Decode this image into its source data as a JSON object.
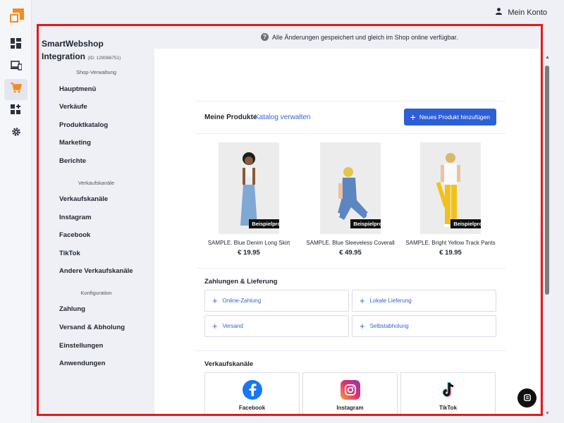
{
  "rail": {
    "items": [
      {
        "icon": "dashboard-icon"
      },
      {
        "icon": "devices-icon"
      },
      {
        "icon": "cart-icon",
        "active": true
      },
      {
        "icon": "apps-add-icon"
      },
      {
        "icon": "gear-icon"
      }
    ]
  },
  "topbar": {
    "account_label": "Mein Konto"
  },
  "notice": {
    "text": "Alle Änderungen gespeichert und gleich im Shop online verfügbar."
  },
  "sidebar": {
    "brand_line1": "SmartWebshop",
    "brand_line2": "Integration",
    "brand_id": "(ID: 129086751)",
    "groups": [
      {
        "label": "Shop-Verwaltung",
        "items": [
          "Hauptmenü",
          "Verkäufe",
          "Produktkatalog",
          "Marketing",
          "Berichte"
        ]
      },
      {
        "label": "Verkaufskanäle",
        "items": [
          "Verkaufskanäle",
          "Instagram",
          "Facebook",
          "TikTok",
          "Andere Verkaufskanäle"
        ]
      },
      {
        "label": "Konfiguration",
        "items": [
          "Zahlung",
          "Versand & Abholung",
          "Einstellungen",
          "Anwendungen"
        ]
      }
    ]
  },
  "products": {
    "title": "Meine Produkte",
    "manage_link": "Katalog verwalten",
    "add_button": "Neues Produkt hinzufügen",
    "items": [
      {
        "name": "SAMPLE. Blue Denim Long Skirt",
        "price": "€ 19.95",
        "badge": "Beispielprodukt"
      },
      {
        "name": "SAMPLE. Blue Sleeveless Coverall",
        "price": "€ 49.95",
        "badge": "Beispielprodukt"
      },
      {
        "name": "SAMPLE. Bright Yellow Track Pants",
        "price": "€ 19.95",
        "badge": "Beispielprodukt"
      }
    ]
  },
  "payments": {
    "title": "Zahlungen & Lieferung",
    "options": [
      "Online-Zahlung",
      "Lokale Lieferung",
      "Versand",
      "Selbstabholung"
    ]
  },
  "channels": {
    "title": "Verkaufskanäle",
    "items": [
      "Facebook",
      "Instagram",
      "TikTok"
    ]
  },
  "colors": {
    "accent": "#2f5fd6",
    "brand_orange": "#f28c1e",
    "frame_red": "#e31b1b"
  }
}
